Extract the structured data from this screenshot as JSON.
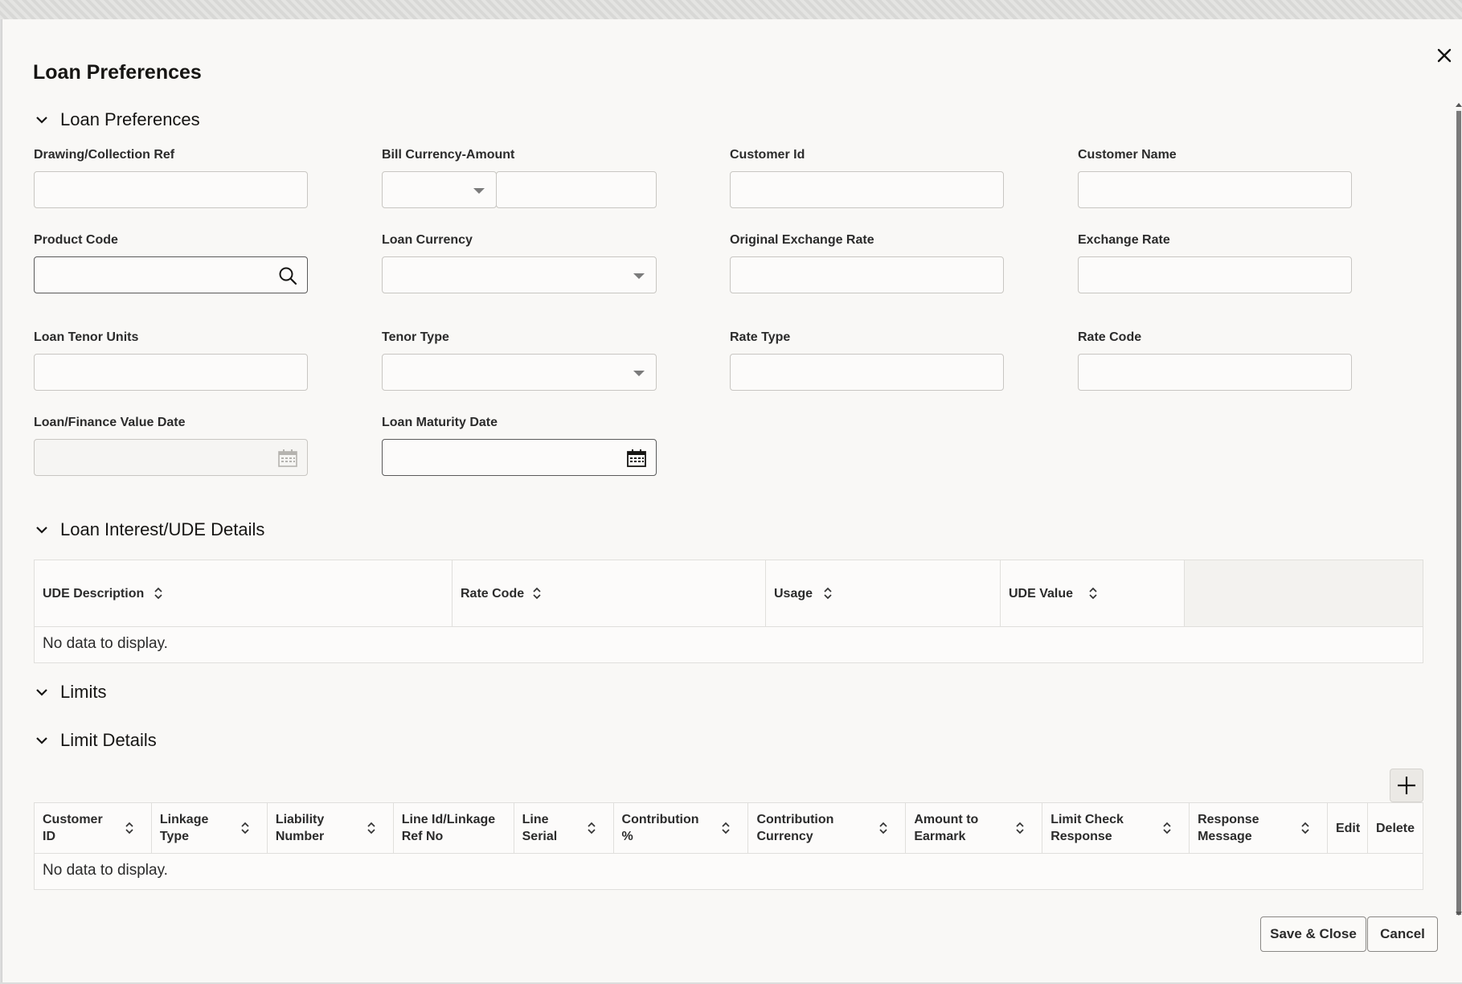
{
  "dialog": {
    "title": "Loan Preferences"
  },
  "sections": {
    "loan_preferences": "Loan Preferences",
    "loan_interest": "Loan Interest/UDE Details",
    "limits": "Limits",
    "limit_details": "Limit Details"
  },
  "fields": {
    "drawing_ref": {
      "label": "Drawing/Collection Ref",
      "value": ""
    },
    "bill_currency_amount": {
      "label": "Bill Currency-Amount",
      "currency": "",
      "amount": ""
    },
    "customer_id": {
      "label": "Customer Id",
      "value": ""
    },
    "customer_name": {
      "label": "Customer Name",
      "value": ""
    },
    "product_code": {
      "label": "Product Code",
      "value": ""
    },
    "loan_currency": {
      "label": "Loan Currency",
      "value": ""
    },
    "original_exchange_rate": {
      "label": "Original Exchange Rate",
      "value": ""
    },
    "exchange_rate": {
      "label": "Exchange Rate",
      "value": ""
    },
    "loan_tenor_units": {
      "label": "Loan Tenor Units",
      "value": ""
    },
    "tenor_type": {
      "label": "Tenor Type",
      "value": ""
    },
    "rate_type": {
      "label": "Rate Type",
      "value": ""
    },
    "rate_code": {
      "label": "Rate Code",
      "value": ""
    },
    "value_date": {
      "label": "Loan/Finance Value Date",
      "value": ""
    },
    "maturity_date": {
      "label": "Loan Maturity Date",
      "value": ""
    }
  },
  "ude_table": {
    "columns": [
      "UDE Description",
      "Rate Code",
      "Usage",
      "UDE Value"
    ],
    "empty_text": "No data to display."
  },
  "limit_table": {
    "columns": [
      [
        "Customer",
        "ID"
      ],
      [
        "Linkage",
        "Type"
      ],
      [
        "Liability",
        "Number"
      ],
      [
        "Line Id/Linkage",
        "Ref No"
      ],
      [
        "Line",
        "Serial"
      ],
      [
        "Contribution",
        "%"
      ],
      [
        "Contribution",
        "Currency"
      ],
      [
        "Amount to",
        "Earmark"
      ],
      [
        "Limit Check",
        "Response"
      ],
      [
        "Response",
        "Message"
      ],
      [
        "Edit",
        ""
      ],
      [
        "Delete",
        ""
      ]
    ],
    "empty_text": "No data to display."
  },
  "icons": {
    "close": "close-icon",
    "search": "search-icon",
    "calendar": "calendar-icon",
    "chevron": "chevron-down-icon",
    "sort": "sort-icon",
    "add": "plus-icon"
  },
  "buttons": {
    "save_close": "Save & Close",
    "cancel": "Cancel"
  }
}
